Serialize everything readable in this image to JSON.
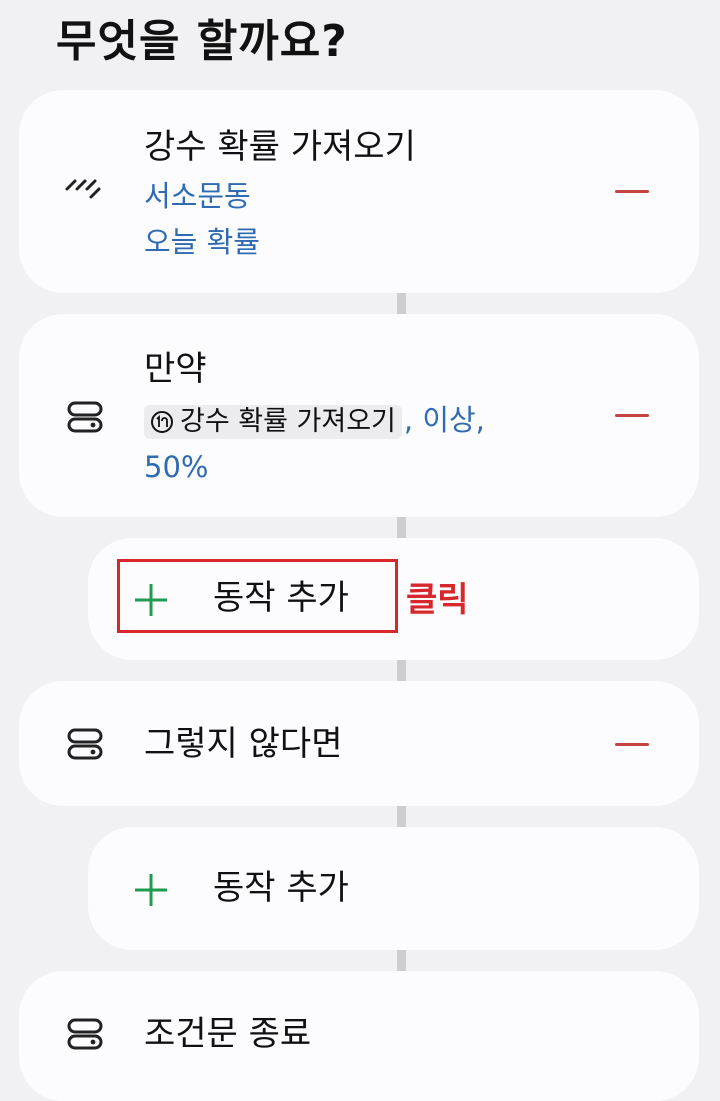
{
  "header": {
    "title": "무엇을 할까요?"
  },
  "steps": [
    {
      "title": "강수 확률 가져오기",
      "sub1": "서소문동",
      "sub2": "오늘 확률",
      "icon": "rain-icon"
    },
    {
      "title": "만약",
      "chip_label": "강수 확률 가져오기",
      "chip_icon": "variable-icon",
      "condition_text": ", 이상,",
      "value_text": "50%",
      "icon": "condition-icon"
    },
    {
      "add_label": "동작 추가"
    },
    {
      "title": "그렇지 않다면",
      "icon": "condition-icon"
    },
    {
      "add_label": "동작 추가"
    },
    {
      "title": "조건문 종료",
      "icon": "condition-icon"
    }
  ],
  "annotation": {
    "label": "클릭",
    "color": "#d7262c"
  },
  "colors": {
    "background": "#f1f1f3",
    "card": "#fcfcfe",
    "link_blue": "#2f6bb3",
    "remove_red": "#c4453f",
    "add_green": "#1f9a4f"
  }
}
